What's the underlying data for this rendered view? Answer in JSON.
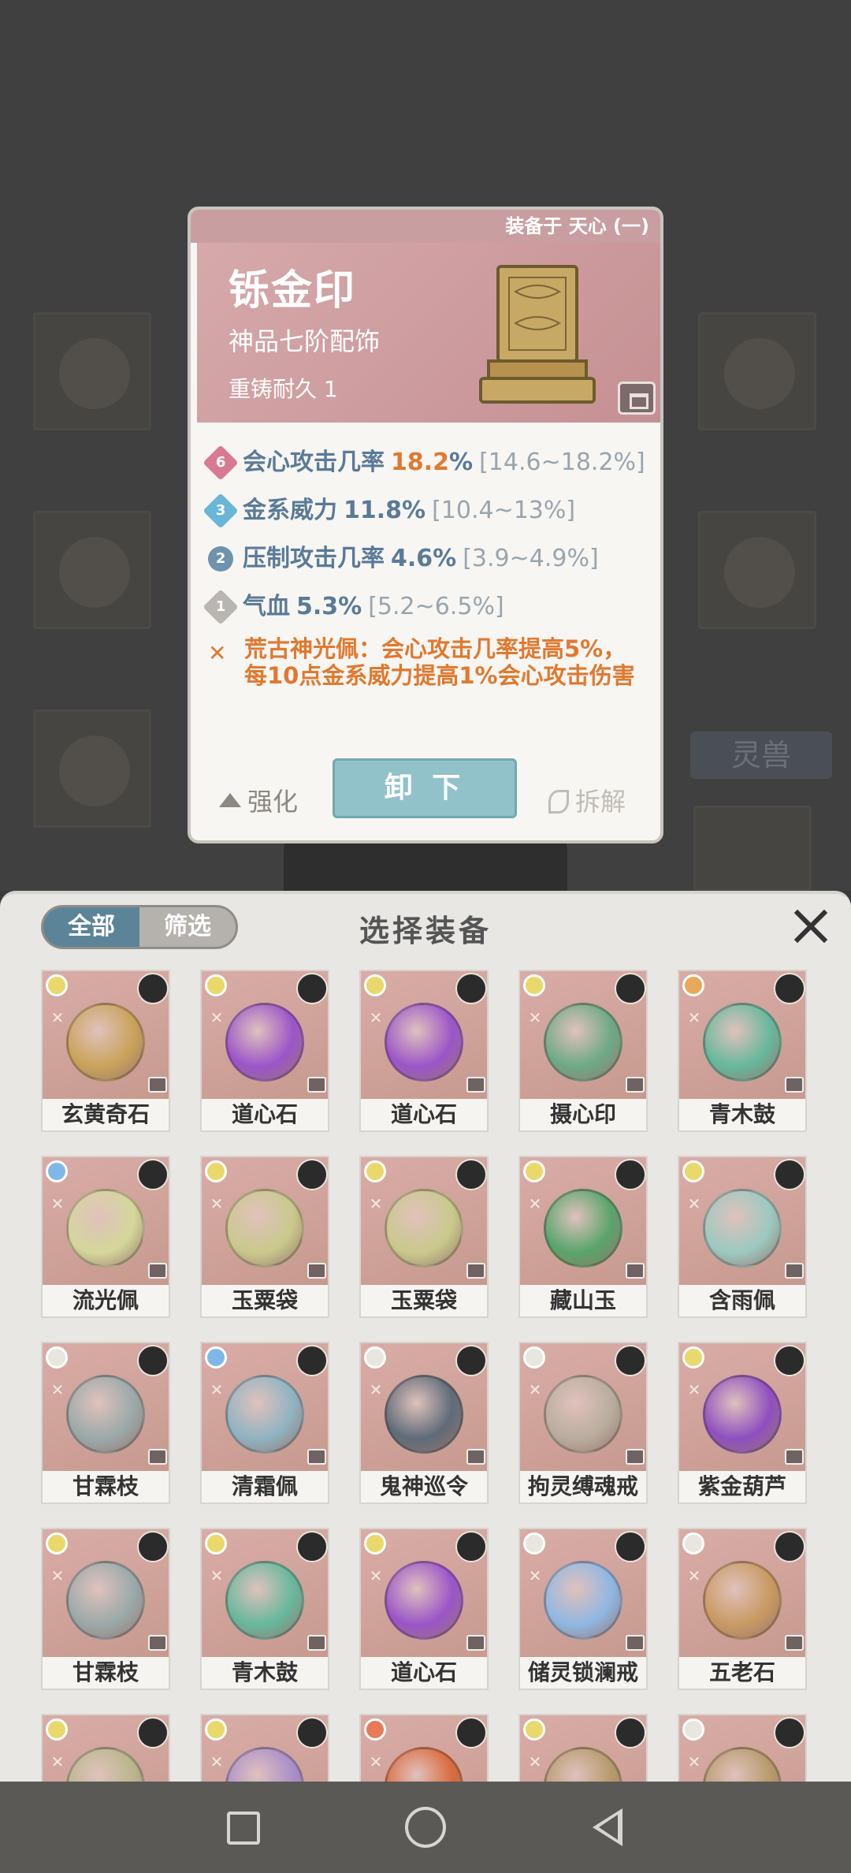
{
  "detail": {
    "equipped_by": "装备于 天心 (一)",
    "name": "铄金印",
    "grade": "神品七阶配饰",
    "durability": "重铸耐久 1",
    "stats": [
      {
        "badge": "6",
        "label": "会心攻击几率",
        "value": "18.2",
        "unit": "%",
        "range": "[14.6~18.2%]",
        "badge_color": "#d77a92"
      },
      {
        "badge": "3",
        "label": "金系威力",
        "value": "11.8%",
        "unit": "",
        "range": "[10.4~13%]",
        "badge_color": "#6ab6d9"
      },
      {
        "badge": "2",
        "label": "压制攻击几率",
        "value": "4.6%",
        "unit": "",
        "range": "[3.9~4.9%]",
        "badge_color": "#6e93ad"
      },
      {
        "badge": "1",
        "label": "气血",
        "value": "5.3%",
        "unit": "",
        "range": "[5.2~6.5%]",
        "badge_color": "#b9b6b2"
      }
    ],
    "set_bonus": "荒古神光佩：会心攻击几率提高5%，每10点金系威力提高1%会心攻击伤害",
    "actions": {
      "upgrade": "强化",
      "unequip": "卸 下",
      "dismantle": "拆解"
    }
  },
  "background": {
    "label": "灵兽"
  },
  "panel": {
    "title": "选择装备",
    "tabs": {
      "all": "全部",
      "filter": "筛选"
    },
    "items": [
      {
        "label": "玄黄奇石",
        "art": "#c9a35a"
      },
      {
        "label": "道心石",
        "art": "#9a55c9"
      },
      {
        "label": "道心石",
        "art": "#9a55c9"
      },
      {
        "label": "摄心印",
        "art": "#6da985"
      },
      {
        "label": "青木鼓",
        "art": "#66b89c"
      },
      {
        "label": "流光佩",
        "art": "#d4d79b"
      },
      {
        "label": "玉粟袋",
        "art": "#c9c98c"
      },
      {
        "label": "玉粟袋",
        "art": "#c9c98c"
      },
      {
        "label": "藏山玉",
        "art": "#58a46a"
      },
      {
        "label": "含雨佩",
        "art": "#9bc9c0"
      },
      {
        "label": "甘霖枝",
        "art": "#9aa9a9"
      },
      {
        "label": "清霜佩",
        "art": "#8fb3c2"
      },
      {
        "label": "鬼神巡令",
        "art": "#5e6b78"
      },
      {
        "label": "拘灵缚魂戒",
        "art": "#b9ad9e"
      },
      {
        "label": "紫金葫芦",
        "art": "#8e4fbf"
      },
      {
        "label": "甘霖枝",
        "art": "#9aa9a9"
      },
      {
        "label": "青木鼓",
        "art": "#66b89c"
      },
      {
        "label": "道心石",
        "art": "#9a55c9"
      },
      {
        "label": "储灵锁澜戒",
        "art": "#8fb7e3"
      },
      {
        "label": "五老石",
        "art": "#c89a62"
      },
      {
        "label": "",
        "art": "#b8b68c"
      },
      {
        "label": "",
        "art": "#a98ec9"
      },
      {
        "label": "",
        "art": "#d96a3d"
      },
      {
        "label": "",
        "art": "#b69a6b"
      },
      {
        "label": "",
        "art": "#b69a6b"
      }
    ],
    "element_colors": [
      "#e9d86b",
      "#e9d86b",
      "#e9d86b",
      "#e9d86b",
      "#e8a95a",
      "#7fb8e8",
      "#e9d86b",
      "#e9d86b",
      "#e9d86b",
      "#e9d86b",
      "#e9e6df",
      "#7fb8e8",
      "#e9e6df",
      "#e9e6df",
      "#e9d86b",
      "#e9d86b",
      "#e9d86b",
      "#e9d86b",
      "#e9e6df",
      "#e9e6df",
      "#e9d86b",
      "#e9d86b",
      "#e87a5a",
      "#e9d86b",
      "#e9e6df"
    ]
  }
}
